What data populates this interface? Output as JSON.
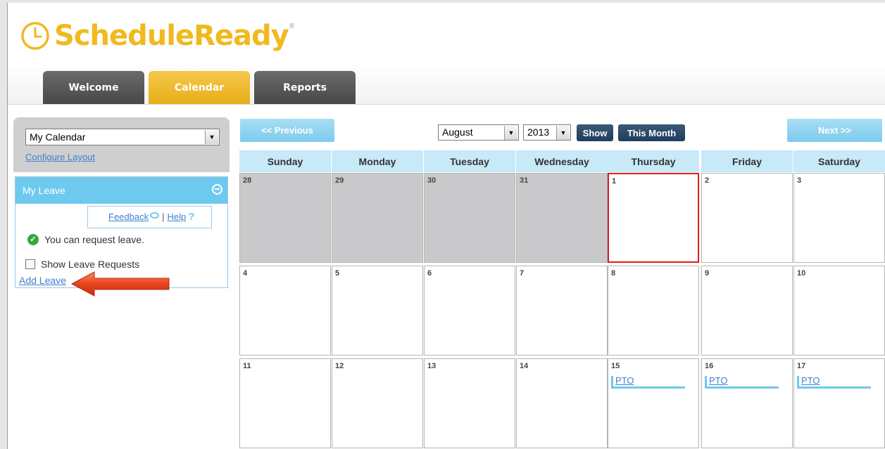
{
  "app": {
    "logo_text": "ScheduleReady",
    "logo_mark": "®"
  },
  "tabs": [
    {
      "label": "Welcome"
    },
    {
      "label": "Calendar",
      "active": true
    },
    {
      "label": "Reports"
    }
  ],
  "sidebar": {
    "calendar_select": "My Calendar",
    "configure_layout": "Configure Layout",
    "leave_panel": {
      "title": "My Leave",
      "feedback": "Feedback",
      "separator": "|",
      "help": "Help",
      "status": "You can request leave.",
      "show_requests": "Show Leave Requests",
      "add_leave": "Add Leave"
    }
  },
  "calendar": {
    "prev_label": "<< Previous",
    "next_label": "Next >>",
    "month": "August",
    "year": "2013",
    "show_label": "Show",
    "this_month_label": "This Month",
    "weekdays": [
      "Sunday",
      "Monday",
      "Tuesday",
      "Wednesday",
      "Thursday",
      "Friday",
      "Saturday"
    ],
    "weeks": [
      [
        {
          "d": "28",
          "other": true
        },
        {
          "d": "29",
          "other": true
        },
        {
          "d": "30",
          "other": true
        },
        {
          "d": "31",
          "other": true
        },
        {
          "d": "1",
          "today": true
        },
        {
          "d": "2"
        },
        {
          "d": "3"
        }
      ],
      [
        {
          "d": "4"
        },
        {
          "d": "5"
        },
        {
          "d": "6"
        },
        {
          "d": "7"
        },
        {
          "d": "8"
        },
        {
          "d": "9"
        },
        {
          "d": "10"
        }
      ],
      [
        {
          "d": "11"
        },
        {
          "d": "12"
        },
        {
          "d": "13"
        },
        {
          "d": "14"
        },
        {
          "d": "15",
          "event": "PTO"
        },
        {
          "d": "16",
          "event": "PTO"
        },
        {
          "d": "17",
          "event": "PTO"
        }
      ]
    ]
  },
  "colors": {
    "brand_yellow": "#f0b91e",
    "accent_blue": "#6ec9ef",
    "link_blue": "#3f7fd0",
    "today_red": "#e01b1b",
    "button_dark": "#1f3d5c"
  }
}
